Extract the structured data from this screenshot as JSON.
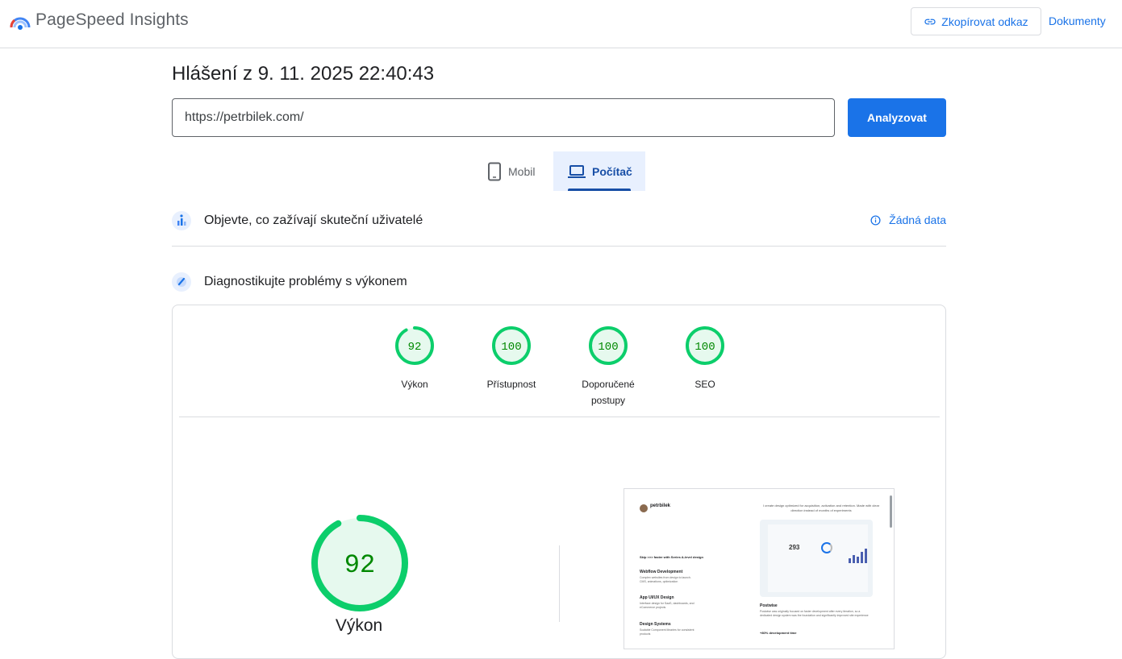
{
  "header": {
    "app_title": "PageSpeed Insights",
    "copy_link_label": "Zkopírovat odkaz",
    "docs_label": "Dokumenty"
  },
  "report": {
    "title": "Hlášení z 9. 11. 2025 22:40:43",
    "url_value": "https://petrbilek.com/",
    "analyze_label": "Analyzovat"
  },
  "tabs": [
    {
      "label": "Mobil",
      "selected": false
    },
    {
      "label": "Počítač",
      "selected": true
    }
  ],
  "sections": {
    "field_data_title": "Objevte, co zažívají skuteční uživatelé",
    "no_data_label": "Žádná data",
    "lab_data_title": "Diagnostikujte problémy s výkonem"
  },
  "scores": [
    {
      "label": "Výkon",
      "value": 92
    },
    {
      "label": "Přístupnost",
      "value": 100
    },
    {
      "label": "Doporučené postupy",
      "value": 100
    },
    {
      "label": "SEO",
      "value": 100
    }
  ],
  "main_score": {
    "label": "Výkon",
    "value": 92
  },
  "colors": {
    "accent": "#1a73e8",
    "pass_green": "#0cce6b",
    "pass_fill": "#e6f9ee",
    "score_text": "#008800"
  },
  "preview": {
    "brand": "petrbilek",
    "intro": "I create design optimized for acquisition, activation and retention. Made with clear direction instead of months of experiments",
    "dash_number": "293",
    "skip_line": "Skip >>> faster with Series A-level design",
    "services": [
      {
        "title": "Webflow Development",
        "text": "Complex websites from design to launch. CMS, animations, optimization"
      },
      {
        "title": "App UI/UX Design",
        "text": "Interface design for SaaS, dashboards, and eCommerce projects"
      },
      {
        "title": "Design Systems",
        "text": "Scalable Component libraries for consistent products"
      }
    ],
    "case_title": "Postwise",
    "case_text": "Postwise was originally focused on faster development after every iteration, so a dedicated design system was the foundation and significantly improved site experience",
    "metric": "+80% development time"
  }
}
